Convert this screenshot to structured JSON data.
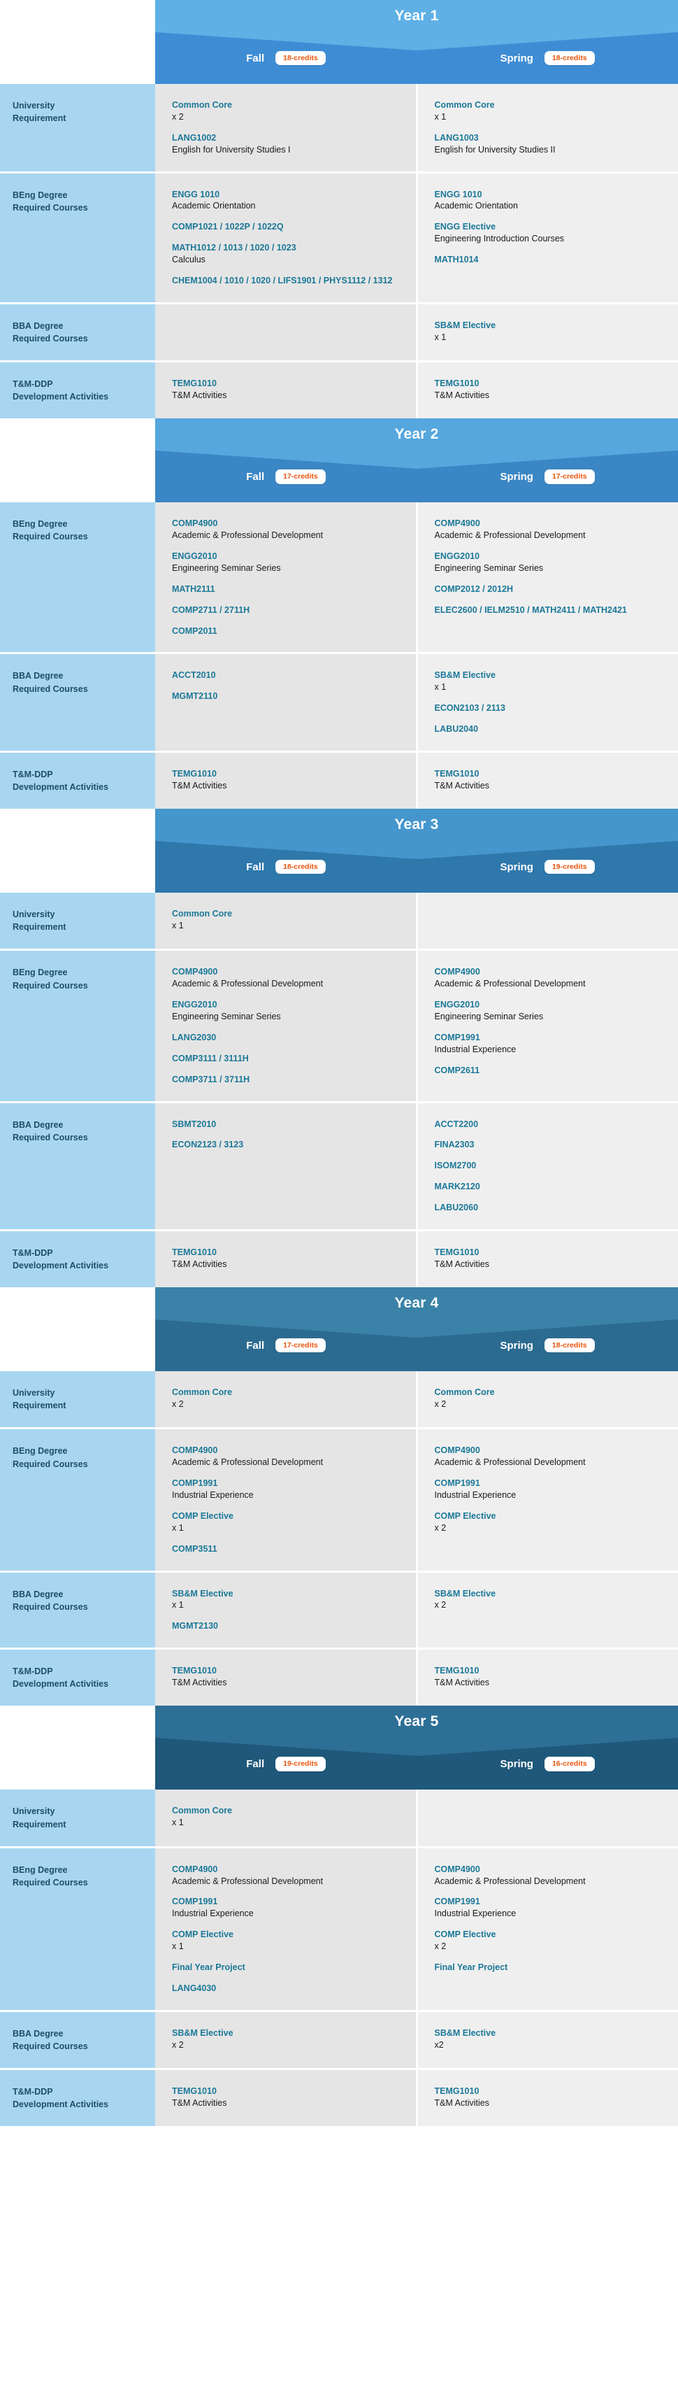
{
  "labels": {
    "university": "University\nRequirement",
    "beng": "BEng Degree\nRequired Courses",
    "bba": "BBA Degree\nRequired Courses",
    "tmddp": "T&M-DDP\nDevelopment Activities",
    "fall": "Fall",
    "spring": "Spring"
  },
  "colors": {
    "label_column": "#A8D6F0",
    "fall_cell": "#E5E5E5",
    "spring_cell": "#EFEFEF",
    "course_code": "#1B7898",
    "credit_badge_text": "#E8540C",
    "year1_top": "#5FB0E5",
    "year1_bottom": "#3E8DD4",
    "year2_top": "#55A7DE",
    "year2_bottom": "#3B86C4",
    "year3_top": "#4596CC",
    "year3_bottom": "#2F78AC",
    "year4_top": "#3B82A8",
    "year4_bottom": "#2C6B90",
    "year5_top": "#2E6F96",
    "year5_bottom": "#1F587A"
  },
  "years": [
    {
      "title": "Year 1",
      "fall_credits": "18-credits",
      "spring_credits": "18-credits",
      "rows": [
        {
          "label": "university",
          "fall": [
            {
              "code": "Common Core",
              "desc": "x 2"
            },
            {
              "code": "LANG1002",
              "desc": "English for University Studies I"
            }
          ],
          "spring": [
            {
              "code": "Common Core",
              "desc": "x 1"
            },
            {
              "code": "LANG1003",
              "desc": "English for University Studies II"
            }
          ]
        },
        {
          "label": "beng",
          "fall": [
            {
              "code": "ENGG 1010",
              "desc": "Academic Orientation"
            },
            {
              "code": "COMP1021 / 1022P / 1022Q",
              "desc": ""
            },
            {
              "code": "MATH1012 / 1013 / 1020 / 1023",
              "desc": "Calculus"
            },
            {
              "code": "CHEM1004 / 1010 / 1020 / LIFS1901 / PHYS1112 / 1312",
              "desc": ""
            }
          ],
          "spring": [
            {
              "code": "ENGG 1010",
              "desc": "Academic Orientation"
            },
            {
              "code": "ENGG Elective",
              "desc": "Engineering Introduction Courses"
            },
            {
              "code": "MATH1014",
              "desc": ""
            }
          ]
        },
        {
          "label": "bba",
          "fall": [],
          "spring": [
            {
              "code": "SB&M Elective",
              "desc": "x 1"
            }
          ]
        },
        {
          "label": "tmddp",
          "fall": [
            {
              "code": "TEMG1010",
              "desc": "T&M Activities"
            }
          ],
          "spring": [
            {
              "code": "TEMG1010",
              "desc": "T&M Activities"
            }
          ]
        }
      ]
    },
    {
      "title": "Year 2",
      "fall_credits": "17-credits",
      "spring_credits": "17-credits",
      "rows": [
        {
          "label": "beng",
          "fall": [
            {
              "code": "COMP4900",
              "desc": "Academic & Professional Development"
            },
            {
              "code": "ENGG2010",
              "desc": "Engineering Seminar Series"
            },
            {
              "code": "MATH2111",
              "desc": ""
            },
            {
              "code": "COMP2711 / 2711H",
              "desc": ""
            },
            {
              "code": "COMP2011",
              "desc": ""
            }
          ],
          "spring": [
            {
              "code": "COMP4900",
              "desc": "Academic & Professional Development"
            },
            {
              "code": "ENGG2010",
              "desc": "Engineering Seminar Series"
            },
            {
              "code": "COMP2012 / 2012H",
              "desc": ""
            },
            {
              "code": "ELEC2600 / IELM2510 / MATH2411 / MATH2421",
              "desc": ""
            }
          ]
        },
        {
          "label": "bba",
          "fall": [
            {
              "code": "ACCT2010",
              "desc": ""
            },
            {
              "code": "MGMT2110",
              "desc": ""
            }
          ],
          "spring": [
            {
              "code": "SB&M Elective",
              "desc": "x 1"
            },
            {
              "code": "ECON2103 / 2113",
              "desc": ""
            },
            {
              "code": "LABU2040",
              "desc": ""
            }
          ]
        },
        {
          "label": "tmddp",
          "fall": [
            {
              "code": "TEMG1010",
              "desc": "T&M Activities"
            }
          ],
          "spring": [
            {
              "code": "TEMG1010",
              "desc": "T&M Activities"
            }
          ]
        }
      ]
    },
    {
      "title": "Year 3",
      "fall_credits": "18-credits",
      "spring_credits": "19-credits",
      "rows": [
        {
          "label": "university",
          "fall": [
            {
              "code": "Common Core",
              "desc": "x 1"
            }
          ],
          "spring": []
        },
        {
          "label": "beng",
          "fall": [
            {
              "code": "COMP4900",
              "desc": "Academic & Professional Development"
            },
            {
              "code": "ENGG2010",
              "desc": "Engineering Seminar Series"
            },
            {
              "code": "LANG2030",
              "desc": ""
            },
            {
              "code": "COMP3111 / 3111H",
              "desc": ""
            },
            {
              "code": "COMP3711 / 3711H",
              "desc": ""
            }
          ],
          "spring": [
            {
              "code": "COMP4900",
              "desc": "Academic & Professional Development"
            },
            {
              "code": "ENGG2010",
              "desc": "Engineering Seminar Series"
            },
            {
              "code": "COMP1991",
              "desc": "Industrial Experience"
            },
            {
              "code": "COMP2611",
              "desc": ""
            }
          ]
        },
        {
          "label": "bba",
          "fall": [
            {
              "code": "SBMT2010",
              "desc": ""
            },
            {
              "code": "ECON2123 / 3123",
              "desc": ""
            }
          ],
          "spring": [
            {
              "code": "ACCT2200",
              "desc": ""
            },
            {
              "code": "FINA2303",
              "desc": ""
            },
            {
              "code": "ISOM2700",
              "desc": ""
            },
            {
              "code": "MARK2120",
              "desc": ""
            },
            {
              "code": "LABU2060",
              "desc": ""
            }
          ]
        },
        {
          "label": "tmddp",
          "fall": [
            {
              "code": "TEMG1010",
              "desc": "T&M Activities"
            }
          ],
          "spring": [
            {
              "code": "TEMG1010",
              "desc": "T&M Activities"
            }
          ]
        }
      ]
    },
    {
      "title": "Year 4",
      "fall_credits": "17-credits",
      "spring_credits": "18-credits",
      "rows": [
        {
          "label": "university",
          "fall": [
            {
              "code": "Common Core",
              "desc": "x 2"
            }
          ],
          "spring": [
            {
              "code": "Common Core",
              "desc": "x 2"
            }
          ]
        },
        {
          "label": "beng",
          "fall": [
            {
              "code": "COMP4900",
              "desc": "Academic & Professional Development"
            },
            {
              "code": "COMP1991",
              "desc": "Industrial Experience"
            },
            {
              "code": "COMP Elective",
              "desc": "x 1"
            },
            {
              "code": "COMP3511",
              "desc": ""
            }
          ],
          "spring": [
            {
              "code": "COMP4900",
              "desc": "Academic & Professional Development"
            },
            {
              "code": "COMP1991",
              "desc": "Industrial Experience"
            },
            {
              "code": "COMP Elective",
              "desc": "x 2"
            }
          ]
        },
        {
          "label": "bba",
          "fall": [
            {
              "code": "SB&M Elective",
              "desc": "x 1"
            },
            {
              "code": "MGMT2130",
              "desc": ""
            }
          ],
          "spring": [
            {
              "code": "SB&M Elective",
              "desc": "x 2"
            }
          ]
        },
        {
          "label": "tmddp",
          "fall": [
            {
              "code": "TEMG1010",
              "desc": "T&M Activities"
            }
          ],
          "spring": [
            {
              "code": "TEMG1010",
              "desc": "T&M Activities"
            }
          ]
        }
      ]
    },
    {
      "title": "Year 5",
      "fall_credits": "19-credits",
      "spring_credits": "16-credits",
      "rows": [
        {
          "label": "university",
          "fall": [
            {
              "code": "Common Core",
              "desc": "x 1"
            }
          ],
          "spring": []
        },
        {
          "label": "beng",
          "fall": [
            {
              "code": "COMP4900",
              "desc": "Academic & Professional Development"
            },
            {
              "code": "COMP1991",
              "desc": "Industrial Experience"
            },
            {
              "code": "COMP Elective",
              "desc": "x 1"
            },
            {
              "code": "Final Year Project",
              "desc": ""
            },
            {
              "code": "LANG4030",
              "desc": ""
            }
          ],
          "spring": [
            {
              "code": "COMP4900",
              "desc": "Academic & Professional Development"
            },
            {
              "code": "COMP1991",
              "desc": "Industrial Experience"
            },
            {
              "code": "COMP Elective",
              "desc": "x 2"
            },
            {
              "code": "Final Year Project",
              "desc": ""
            }
          ]
        },
        {
          "label": "bba",
          "fall": [
            {
              "code": "SB&M Elective",
              "desc": "x 2"
            }
          ],
          "spring": [
            {
              "code": "SB&M Elective",
              "desc": "x2"
            }
          ]
        },
        {
          "label": "tmddp",
          "fall": [
            {
              "code": "TEMG1010",
              "desc": "T&M Activities"
            }
          ],
          "spring": [
            {
              "code": "TEMG1010",
              "desc": "T&M Activities"
            }
          ]
        }
      ]
    }
  ]
}
